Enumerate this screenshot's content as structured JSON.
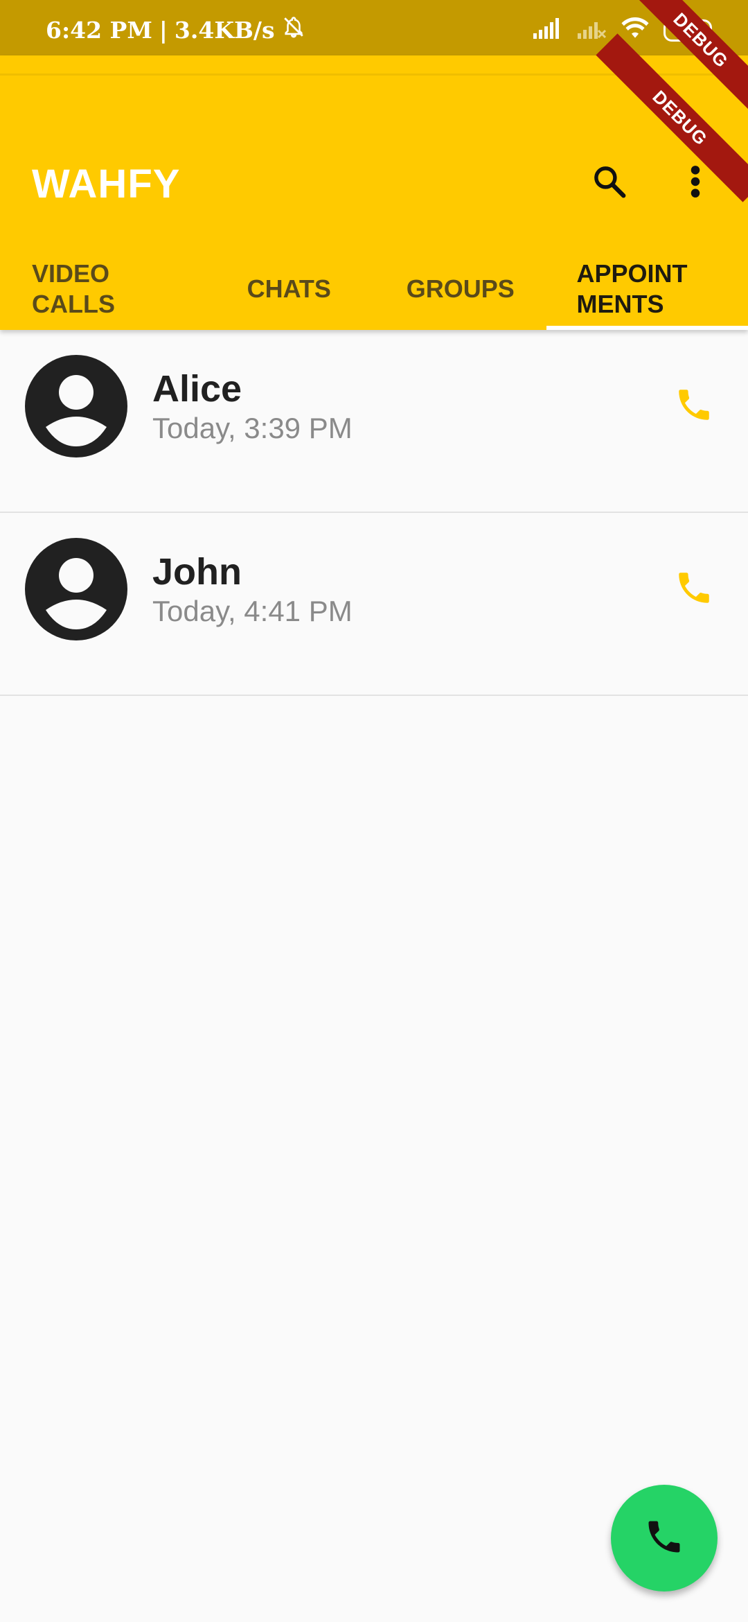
{
  "status_bar": {
    "time": "6:42 PM",
    "separator": "|",
    "network_speed": "3.4KB/s",
    "battery_level": "22",
    "icons": [
      "mute-bell-icon",
      "signal-icon",
      "signal-no-service-icon",
      "wifi-icon",
      "battery-icon"
    ]
  },
  "app_bar": {
    "title": "WAHFY",
    "icons": [
      "search-icon",
      "more-vert-icon"
    ],
    "background": "#ffca00"
  },
  "tabs": [
    {
      "label": "VIDEO\nCALLS",
      "selected": false
    },
    {
      "label": "CHATS",
      "selected": false
    },
    {
      "label": "GROUPS",
      "selected": false
    },
    {
      "label": "APPOINT\nMENTS",
      "selected": true
    }
  ],
  "appointments": [
    {
      "name": "Alice",
      "time": "Today, 3:39 PM"
    },
    {
      "name": "John",
      "time": "Today, 4:41 PM"
    }
  ],
  "colors": {
    "accent": "#ffca00",
    "call_icon": "#ffca00",
    "fab": "#25d366",
    "debug_ribbon": "#a3180f"
  },
  "debug_banner": {
    "label": "DEBUG"
  },
  "fab": {
    "icon": "phone-icon"
  }
}
